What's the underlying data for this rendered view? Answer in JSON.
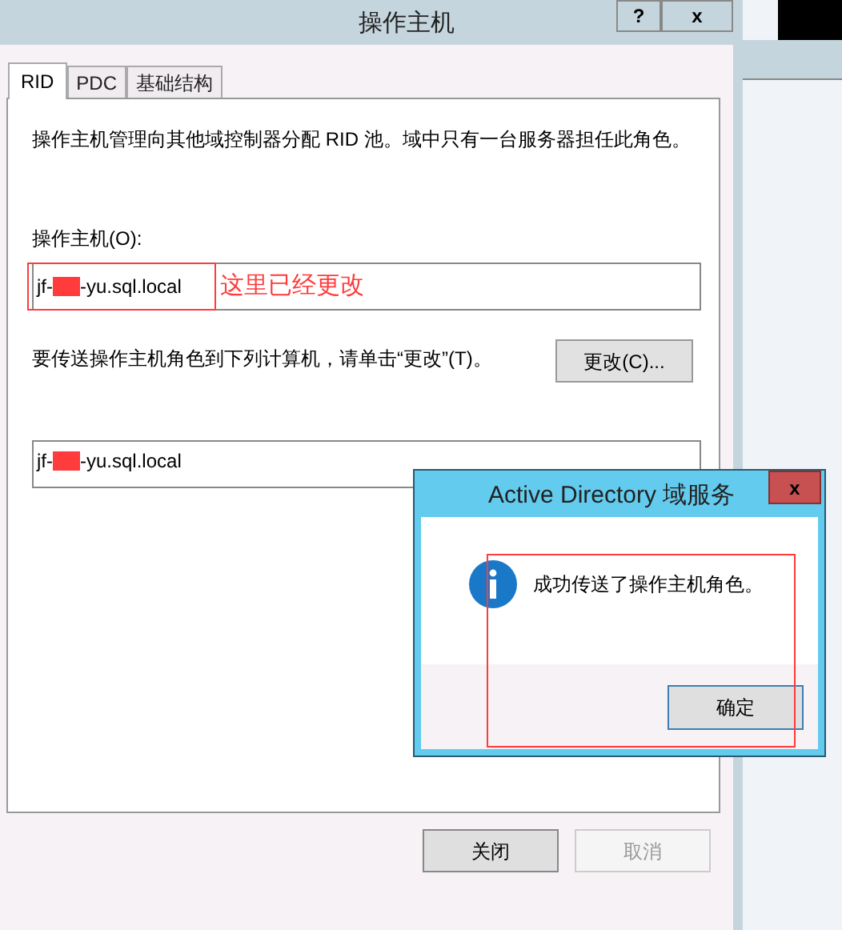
{
  "window": {
    "title": "操作主机",
    "help": "?",
    "close": "x"
  },
  "tabs": [
    {
      "label": "RID",
      "selected": true
    },
    {
      "label": "PDC",
      "selected": false
    },
    {
      "label": "基础结构",
      "selected": false
    }
  ],
  "description": "操作主机管理向其他域控制器分配 RID 池。域中只有一台服务器担任此角色。",
  "operations_master": {
    "label": "操作主机(O):",
    "value_prefix": "jf-",
    "value_suffix": "-yu.sql.local",
    "annotation": "这里已经更改"
  },
  "transfer": {
    "text": "要传送操作主机角色到下列计算机，请单击“更改”(T)。",
    "button": "更改(C)...",
    "value_prefix": "jf-",
    "value_suffix": "-yu.sql.local"
  },
  "buttons": [
    {
      "label": "关闭",
      "disabled": false
    },
    {
      "label": "取消",
      "disabled": true
    }
  ],
  "message_box": {
    "title": "Active Directory 域服务",
    "close": "x",
    "message": "成功传送了操作主机角色。",
    "button": "确定"
  }
}
